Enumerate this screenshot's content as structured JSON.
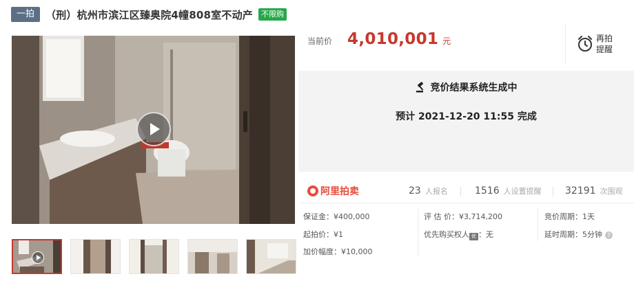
{
  "header": {
    "round_badge": "一拍",
    "title": "（刑）杭州市滨江区臻奥院4幢808室不动产",
    "tag": "不限购"
  },
  "price": {
    "label": "当前价",
    "value": "4,010,001",
    "unit": "元"
  },
  "remind": {
    "label": "再拍提醒",
    "icon": "alarm-clock-icon"
  },
  "status": {
    "line1": "竞价结果系统生成中",
    "line2": "预计 2021-12-20 11:55 完成",
    "icon": "gavel-icon"
  },
  "stats": {
    "logo_text": "阿里拍卖",
    "items": [
      {
        "num": "23",
        "label": "人报名"
      },
      {
        "num": "1516",
        "label": "人设置提醒"
      },
      {
        "num": "32191",
        "label": "次围观"
      }
    ]
  },
  "details": {
    "deposit": "保证金：¥400,000",
    "appraisal": "评 估 价：¥3,714,200",
    "cycle": "竞价周期：1天",
    "start_price": "起拍价：¥1",
    "priority_label": "优先购买权人",
    "priority_icon": "优",
    "priority_value": "：无",
    "delay": "延时周期：5分钟",
    "increment": "加价幅度：¥10,000"
  },
  "media": {
    "play_icon": "play-icon",
    "thumbnail_count": 5
  },
  "colors": {
    "accent_red": "#c8372c",
    "badge_blue": "#5b6f86",
    "tag_green": "#27a84a",
    "status_bg": "#f3f3f3"
  }
}
